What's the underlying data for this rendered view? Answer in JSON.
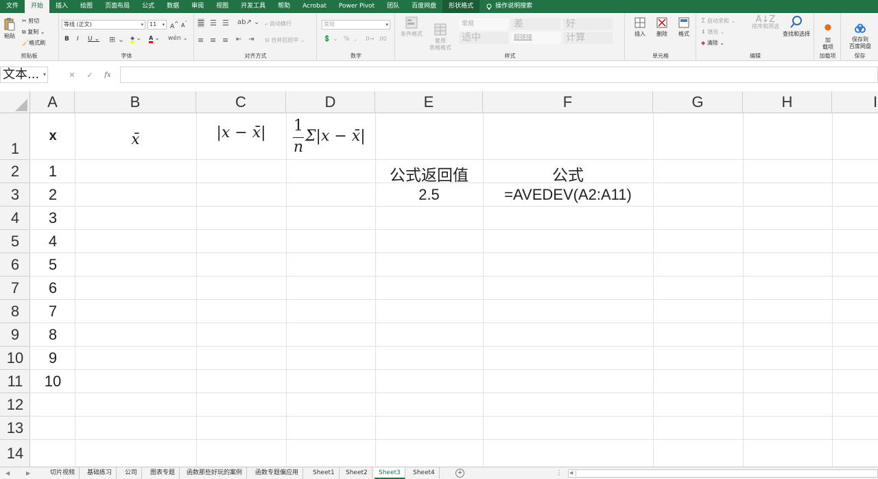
{
  "ribbon_tabs": [
    "文件",
    "开始",
    "插入",
    "绘图",
    "页面布局",
    "公式",
    "数据",
    "审阅",
    "视图",
    "开发工具",
    "帮助",
    "Acrobat",
    "Power Pivot",
    "团队",
    "百度网盘",
    "形状格式"
  ],
  "active_tab": "开始",
  "tell_me": "操作说明搜索",
  "clipboard": {
    "paste": "粘贴",
    "cut": "剪切",
    "copy": "复制",
    "format_painter": "格式刷",
    "label": "剪贴板"
  },
  "font": {
    "name": "等线 (正文)",
    "size": "11",
    "label": "字体"
  },
  "alignment": {
    "wrap": "自动换行",
    "merge": "合并后居中",
    "label": "对齐方式"
  },
  "number": {
    "format": "常规",
    "label": "数字"
  },
  "styles": {
    "conditional": "条件格式",
    "table": "套用\n表格格式",
    "cells": [
      {
        "name": "常规",
        "bg": "#ffffff",
        "color": "#333333"
      },
      {
        "name": "差",
        "bg": "#ffc7ce",
        "color": "#9c0006"
      },
      {
        "name": "好",
        "bg": "#c6efce",
        "color": "#006100"
      },
      {
        "name": "适中",
        "bg": "#ffeb9c",
        "color": "#9c5700"
      },
      {
        "name": "超链接",
        "bg": "#ffffff",
        "color": "#0563c1"
      },
      {
        "name": "计算",
        "bg": "#f2f2f2",
        "color": "#fa7d00"
      }
    ],
    "label": "样式"
  },
  "cells_group": {
    "insert": "插入",
    "delete": "删除",
    "format": "格式",
    "label": "单元格"
  },
  "editing": {
    "autosum": "自动求和",
    "fill": "填充",
    "clear": "清除",
    "sort": "排序和筛选",
    "find": "查找和选择",
    "label": "编辑"
  },
  "addins": {
    "btn": "加\n载项",
    "label": "加载项"
  },
  "save": {
    "btn": "保存到\n百度网盘",
    "label": "保存"
  },
  "namebox": "文本...",
  "columns": [
    "A",
    "B",
    "C",
    "D",
    "E",
    "F",
    "G",
    "H",
    "I"
  ],
  "rows": [
    "1",
    "2",
    "3",
    "4",
    "5",
    "6",
    "7",
    "8",
    "9",
    "10",
    "11",
    "12",
    "13",
    "14"
  ],
  "header_cells": {
    "A1": "x",
    "B1": "x̄",
    "C1": "|x − x̄|",
    "D1_num": "1",
    "D1_den": "n",
    "D1_rest": "Σ|x − x̄|"
  },
  "x_values": [
    "1",
    "2",
    "3",
    "4",
    "5",
    "6",
    "7",
    "8",
    "9",
    "10"
  ],
  "E2": "公式返回值",
  "E3": "2.5",
  "F2": "公式",
  "F3": "=AVEDEV(A2:A11)",
  "sheet_tabs": [
    "切片视频",
    "基础练习",
    "公司",
    "图表专题",
    "函数那些好玩的案例",
    "函数专题偏应用",
    "Sheet1",
    "Sheet2",
    "Sheet3",
    "Sheet4"
  ],
  "active_sheet": "Sheet3",
  "accent": "#217346"
}
